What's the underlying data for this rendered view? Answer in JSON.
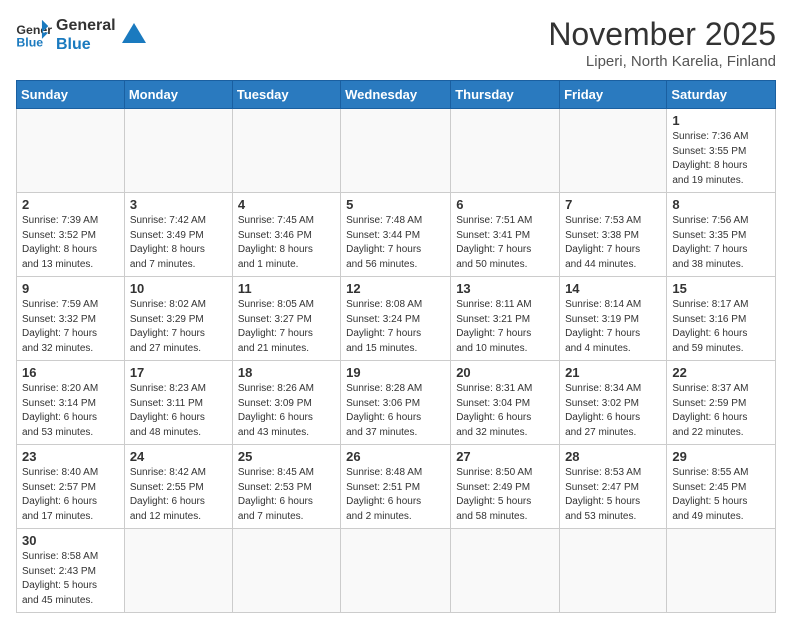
{
  "header": {
    "logo_general": "General",
    "logo_blue": "Blue",
    "month_title": "November 2025",
    "location": "Liperi, North Karelia, Finland"
  },
  "weekdays": [
    "Sunday",
    "Monday",
    "Tuesday",
    "Wednesday",
    "Thursday",
    "Friday",
    "Saturday"
  ],
  "weeks": [
    [
      {
        "day": "",
        "info": ""
      },
      {
        "day": "",
        "info": ""
      },
      {
        "day": "",
        "info": ""
      },
      {
        "day": "",
        "info": ""
      },
      {
        "day": "",
        "info": ""
      },
      {
        "day": "",
        "info": ""
      },
      {
        "day": "1",
        "info": "Sunrise: 7:36 AM\nSunset: 3:55 PM\nDaylight: 8 hours\nand 19 minutes."
      }
    ],
    [
      {
        "day": "2",
        "info": "Sunrise: 7:39 AM\nSunset: 3:52 PM\nDaylight: 8 hours\nand 13 minutes."
      },
      {
        "day": "3",
        "info": "Sunrise: 7:42 AM\nSunset: 3:49 PM\nDaylight: 8 hours\nand 7 minutes."
      },
      {
        "day": "4",
        "info": "Sunrise: 7:45 AM\nSunset: 3:46 PM\nDaylight: 8 hours\nand 1 minute."
      },
      {
        "day": "5",
        "info": "Sunrise: 7:48 AM\nSunset: 3:44 PM\nDaylight: 7 hours\nand 56 minutes."
      },
      {
        "day": "6",
        "info": "Sunrise: 7:51 AM\nSunset: 3:41 PM\nDaylight: 7 hours\nand 50 minutes."
      },
      {
        "day": "7",
        "info": "Sunrise: 7:53 AM\nSunset: 3:38 PM\nDaylight: 7 hours\nand 44 minutes."
      },
      {
        "day": "8",
        "info": "Sunrise: 7:56 AM\nSunset: 3:35 PM\nDaylight: 7 hours\nand 38 minutes."
      }
    ],
    [
      {
        "day": "9",
        "info": "Sunrise: 7:59 AM\nSunset: 3:32 PM\nDaylight: 7 hours\nand 32 minutes."
      },
      {
        "day": "10",
        "info": "Sunrise: 8:02 AM\nSunset: 3:29 PM\nDaylight: 7 hours\nand 27 minutes."
      },
      {
        "day": "11",
        "info": "Sunrise: 8:05 AM\nSunset: 3:27 PM\nDaylight: 7 hours\nand 21 minutes."
      },
      {
        "day": "12",
        "info": "Sunrise: 8:08 AM\nSunset: 3:24 PM\nDaylight: 7 hours\nand 15 minutes."
      },
      {
        "day": "13",
        "info": "Sunrise: 8:11 AM\nSunset: 3:21 PM\nDaylight: 7 hours\nand 10 minutes."
      },
      {
        "day": "14",
        "info": "Sunrise: 8:14 AM\nSunset: 3:19 PM\nDaylight: 7 hours\nand 4 minutes."
      },
      {
        "day": "15",
        "info": "Sunrise: 8:17 AM\nSunset: 3:16 PM\nDaylight: 6 hours\nand 59 minutes."
      }
    ],
    [
      {
        "day": "16",
        "info": "Sunrise: 8:20 AM\nSunset: 3:14 PM\nDaylight: 6 hours\nand 53 minutes."
      },
      {
        "day": "17",
        "info": "Sunrise: 8:23 AM\nSunset: 3:11 PM\nDaylight: 6 hours\nand 48 minutes."
      },
      {
        "day": "18",
        "info": "Sunrise: 8:26 AM\nSunset: 3:09 PM\nDaylight: 6 hours\nand 43 minutes."
      },
      {
        "day": "19",
        "info": "Sunrise: 8:28 AM\nSunset: 3:06 PM\nDaylight: 6 hours\nand 37 minutes."
      },
      {
        "day": "20",
        "info": "Sunrise: 8:31 AM\nSunset: 3:04 PM\nDaylight: 6 hours\nand 32 minutes."
      },
      {
        "day": "21",
        "info": "Sunrise: 8:34 AM\nSunset: 3:02 PM\nDaylight: 6 hours\nand 27 minutes."
      },
      {
        "day": "22",
        "info": "Sunrise: 8:37 AM\nSunset: 2:59 PM\nDaylight: 6 hours\nand 22 minutes."
      }
    ],
    [
      {
        "day": "23",
        "info": "Sunrise: 8:40 AM\nSunset: 2:57 PM\nDaylight: 6 hours\nand 17 minutes."
      },
      {
        "day": "24",
        "info": "Sunrise: 8:42 AM\nSunset: 2:55 PM\nDaylight: 6 hours\nand 12 minutes."
      },
      {
        "day": "25",
        "info": "Sunrise: 8:45 AM\nSunset: 2:53 PM\nDaylight: 6 hours\nand 7 minutes."
      },
      {
        "day": "26",
        "info": "Sunrise: 8:48 AM\nSunset: 2:51 PM\nDaylight: 6 hours\nand 2 minutes."
      },
      {
        "day": "27",
        "info": "Sunrise: 8:50 AM\nSunset: 2:49 PM\nDaylight: 5 hours\nand 58 minutes."
      },
      {
        "day": "28",
        "info": "Sunrise: 8:53 AM\nSunset: 2:47 PM\nDaylight: 5 hours\nand 53 minutes."
      },
      {
        "day": "29",
        "info": "Sunrise: 8:55 AM\nSunset: 2:45 PM\nDaylight: 5 hours\nand 49 minutes."
      }
    ],
    [
      {
        "day": "30",
        "info": "Sunrise: 8:58 AM\nSunset: 2:43 PM\nDaylight: 5 hours\nand 45 minutes."
      },
      {
        "day": "",
        "info": ""
      },
      {
        "day": "",
        "info": ""
      },
      {
        "day": "",
        "info": ""
      },
      {
        "day": "",
        "info": ""
      },
      {
        "day": "",
        "info": ""
      },
      {
        "day": "",
        "info": ""
      }
    ]
  ]
}
